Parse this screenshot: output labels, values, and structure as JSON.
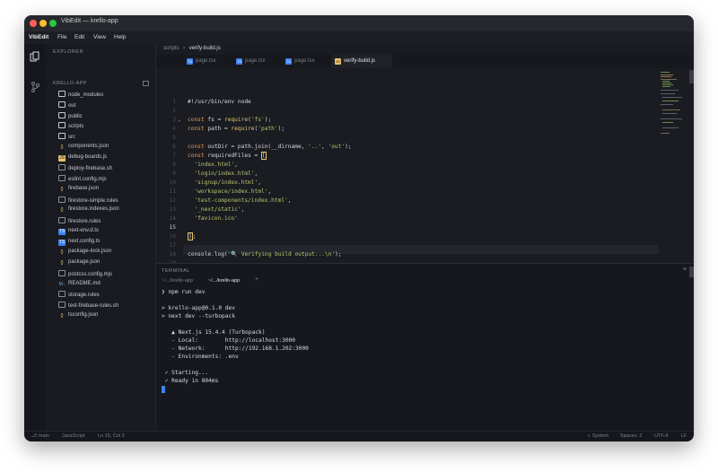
{
  "window": {
    "title": "VibEdit — krello-app"
  },
  "menubar": {
    "app": "VibEdit",
    "items": [
      "File",
      "Edit",
      "View",
      "Help"
    ]
  },
  "sidebar": {
    "header": "EXPLORER",
    "project": "KRELLO-APP",
    "items": [
      {
        "label": "node_modules",
        "icon": "folder-icon"
      },
      {
        "label": "out",
        "icon": "folder-icon"
      },
      {
        "label": "public",
        "icon": "folder-icon"
      },
      {
        "label": "scripts",
        "icon": "folder-icon"
      },
      {
        "label": "src",
        "icon": "folder-icon"
      },
      {
        "label": "components.json",
        "icon": "json-icon"
      },
      {
        "label": "debug-boards.js",
        "icon": "js-icon"
      },
      {
        "label": "deploy-firebase.sh",
        "icon": "file-icon"
      },
      {
        "label": "eslint.config.mjs",
        "icon": "file-icon"
      },
      {
        "label": "firebase.json",
        "icon": "json-icon"
      },
      {
        "label": "firestore-simple.rules",
        "icon": "file-icon"
      },
      {
        "label": "firestore.indexes.json",
        "icon": "json-icon"
      },
      {
        "label": "firestore.rules",
        "icon": "file-icon"
      },
      {
        "label": "next-env.d.ts",
        "icon": "ts-icon"
      },
      {
        "label": "next.config.ts",
        "icon": "ts-icon"
      },
      {
        "label": "package-lock.json",
        "icon": "json-icon"
      },
      {
        "label": "package.json",
        "icon": "json-icon"
      },
      {
        "label": "postcss.config.mjs",
        "icon": "file-icon"
      },
      {
        "label": "README.md",
        "icon": "md-icon"
      },
      {
        "label": "storage.rules",
        "icon": "file-icon"
      },
      {
        "label": "test-firebase-rules.sh",
        "icon": "file-icon"
      },
      {
        "label": "tsconfig.json",
        "icon": "json-icon"
      }
    ]
  },
  "breadcrumb": {
    "folder": "scripts",
    "sep": "›",
    "file": "verify-build.js"
  },
  "tabs": [
    {
      "label": "page.tsx",
      "icon": "ts-icon"
    },
    {
      "label": "page.tsx",
      "icon": "ts-icon"
    },
    {
      "label": "page.tsx",
      "icon": "ts-icon"
    },
    {
      "label": "verify-build.js",
      "icon": "js-icon"
    }
  ],
  "editor": {
    "line_numbers": [
      "1",
      "2",
      "3",
      "4",
      "5",
      "6",
      "7",
      "8",
      "9",
      "10",
      "11",
      "12",
      "13",
      "14",
      "15",
      "16",
      "17",
      "18",
      "19"
    ],
    "current_line": "15"
  },
  "terminal": {
    "header": "TERMINAL",
    "close": "×",
    "tabs": [
      "~/.../krello-app",
      "~/.../krello-app"
    ],
    "add": "+",
    "lines": [
      "❯ npm run dev",
      "",
      "> krello-app@0.1.0 dev",
      "> next dev --turbopack",
      "",
      "   ▲ Next.js 15.4.4 (Turbopack)",
      "   - Local:        http://localhost:3000",
      "   - Network:      http://192.168.1.202:3000",
      "   - Environments: .env",
      "",
      " ✓ Starting...",
      " ✓ Ready in 804ms"
    ]
  },
  "status": {
    "branch": "main",
    "language": "JavaScript",
    "position": "Ln 15, Col 3",
    "theme": "System",
    "spaces": "Spaces: 2",
    "encoding": "UTF-8",
    "eol": "LF"
  },
  "colors": {
    "accent": "#3b82f6",
    "keyword": "#e09a4f",
    "string": "#b9c46a",
    "function": "#e8c36a"
  }
}
